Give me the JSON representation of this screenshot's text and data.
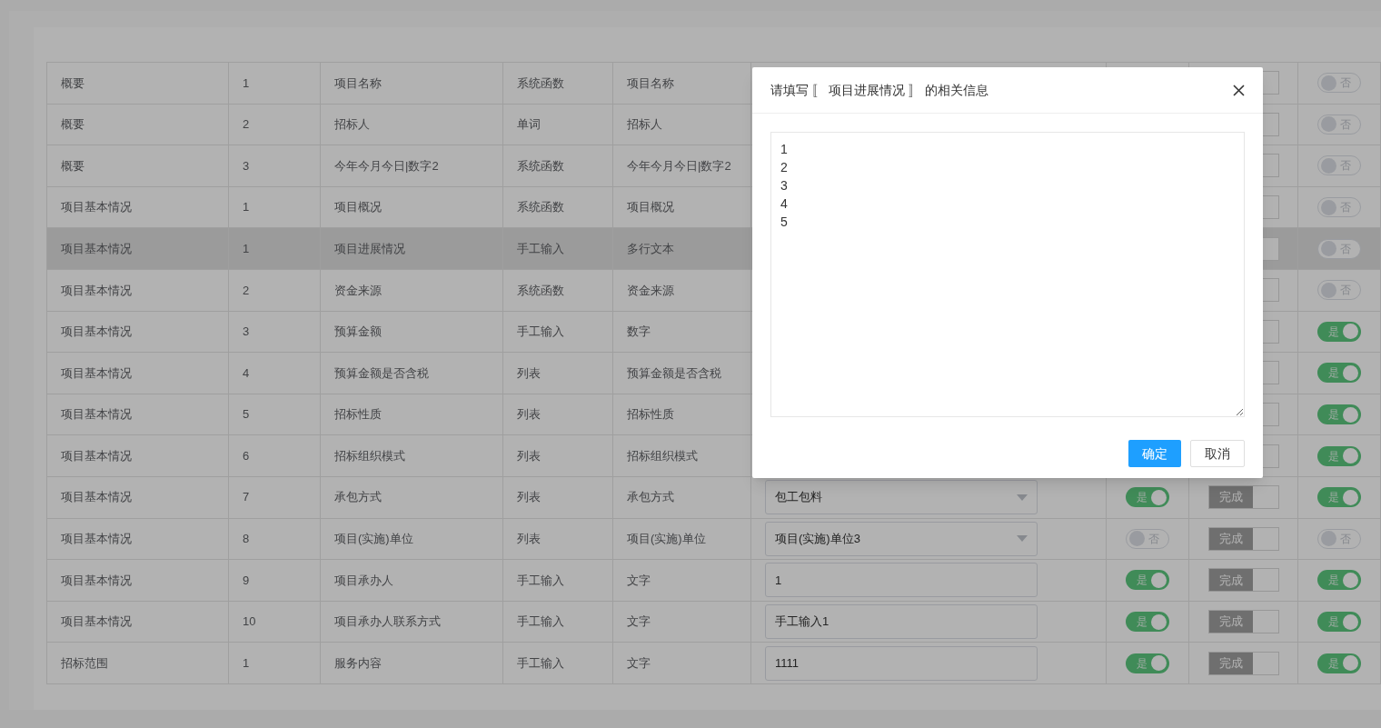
{
  "table": {
    "rows": [
      {
        "selected": false,
        "section": "概要",
        "index": "1",
        "name": "项目名称",
        "source": "系统函数",
        "type": "项目名称",
        "enabled": {
          "on": false,
          "label": "否"
        }
      },
      {
        "selected": false,
        "section": "概要",
        "index": "2",
        "name": "招标人",
        "source": "单词",
        "type": "招标人",
        "enabled": {
          "on": false,
          "label": "否"
        }
      },
      {
        "selected": false,
        "section": "概要",
        "index": "3",
        "name": "今年今月今日|数字2",
        "source": "系统函数",
        "type": "今年今月今日|数字2",
        "enabled": {
          "on": false,
          "label": "否"
        }
      },
      {
        "selected": false,
        "section": "项目基本情况",
        "index": "1",
        "name": "项目概况",
        "source": "系统函数",
        "type": "项目概况",
        "enabled": {
          "on": false,
          "label": "否"
        }
      },
      {
        "selected": true,
        "section": "项目基本情况",
        "index": "1",
        "name": "项目进展情况",
        "source": "手工输入",
        "type": "多行文本",
        "enabled": {
          "on": false,
          "label": "否"
        }
      },
      {
        "selected": false,
        "section": "项目基本情况",
        "index": "2",
        "name": "资金来源",
        "source": "系统函数",
        "type": "资金来源",
        "enabled": {
          "on": false,
          "label": "否"
        }
      },
      {
        "selected": false,
        "section": "项目基本情况",
        "index": "3",
        "name": "预算金额",
        "source": "手工输入",
        "type": "数字",
        "enabled": {
          "on": true,
          "label": "是"
        }
      },
      {
        "selected": false,
        "section": "项目基本情况",
        "index": "4",
        "name": "预算金额是否含税",
        "source": "列表",
        "type": "预算金额是否含税",
        "enabled": {
          "on": true,
          "label": "是"
        }
      },
      {
        "selected": false,
        "section": "项目基本情况",
        "index": "5",
        "name": "招标性质",
        "source": "列表",
        "type": "招标性质",
        "enabled": {
          "on": true,
          "label": "是"
        }
      },
      {
        "selected": false,
        "section": "项目基本情况",
        "index": "6",
        "name": "招标组织模式",
        "source": "列表",
        "type": "招标组织模式",
        "enabled": {
          "on": true,
          "label": "是"
        }
      },
      {
        "selected": false,
        "section": "项目基本情况",
        "index": "7",
        "name": "承包方式",
        "source": "列表",
        "type": "承包方式",
        "field": {
          "kind": "select",
          "value": "包工包料"
        },
        "required": {
          "on": true,
          "label": "是"
        },
        "done": "完成",
        "enabled": {
          "on": true,
          "label": "是"
        }
      },
      {
        "selected": false,
        "section": "项目基本情况",
        "index": "8",
        "name": "项目(实施)单位",
        "source": "列表",
        "type": "项目(实施)单位",
        "field": {
          "kind": "select",
          "value": "项目(实施)单位3"
        },
        "required": {
          "on": false,
          "label": "否"
        },
        "done": "完成",
        "enabled": {
          "on": false,
          "label": "否"
        }
      },
      {
        "selected": false,
        "section": "项目基本情况",
        "index": "9",
        "name": "项目承办人",
        "source": "手工输入",
        "type": "文字",
        "field": {
          "kind": "input",
          "value": "1"
        },
        "required": {
          "on": true,
          "label": "是"
        },
        "done": "完成",
        "enabled": {
          "on": true,
          "label": "是"
        }
      },
      {
        "selected": false,
        "section": "项目基本情况",
        "index": "10",
        "name": "项目承办人联系方式",
        "source": "手工输入",
        "type": "文字",
        "field": {
          "kind": "input",
          "value": "手工输入1"
        },
        "required": {
          "on": true,
          "label": "是"
        },
        "done": "完成",
        "enabled": {
          "on": true,
          "label": "是"
        }
      },
      {
        "selected": false,
        "section": "招标范围",
        "index": "1",
        "name": "服务内容",
        "source": "手工输入",
        "type": "文字",
        "field": {
          "kind": "input",
          "value": "1111"
        },
        "required": {
          "on": true,
          "label": "是"
        },
        "done": "完成",
        "enabled": {
          "on": true,
          "label": "是"
        }
      }
    ]
  },
  "dialog": {
    "title": "请填写 〚 项目进展情况 〛 的相关信息",
    "text": "1\n2\n3\n4\n5",
    "buttons": [
      {
        "label": "确定",
        "kind": "primary"
      },
      {
        "label": "取消",
        "kind": "default"
      }
    ]
  }
}
